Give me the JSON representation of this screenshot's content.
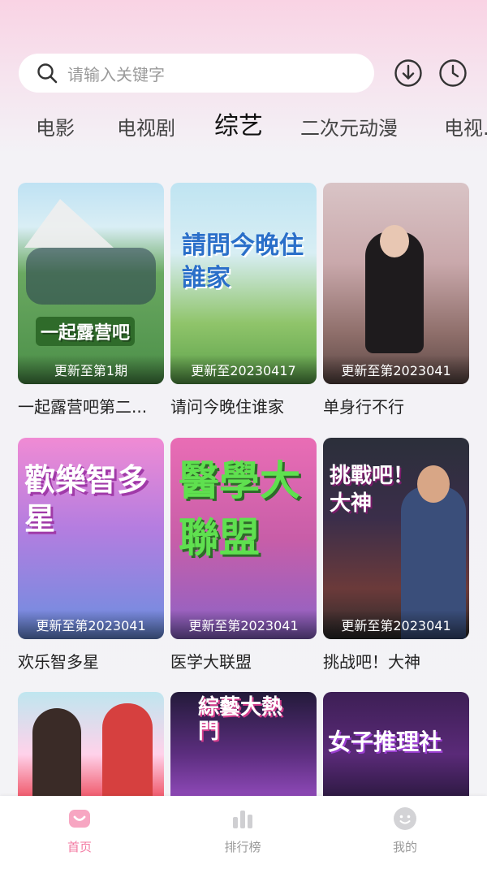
{
  "search": {
    "placeholder": "请输入关键字"
  },
  "tabs": [
    {
      "label": "电影"
    },
    {
      "label": "电视剧"
    },
    {
      "label": "综艺"
    },
    {
      "label": "二次元动漫"
    },
    {
      "label": "电视..."
    }
  ],
  "active_tab": "综艺",
  "shows": [
    {
      "title": "一起露营吧第二...",
      "badge": "更新至第1期",
      "art_text": "一起露营吧"
    },
    {
      "title": "请问今晚住谁家",
      "badge": "更新至20230417",
      "art_text": "請問今晚住誰家"
    },
    {
      "title": "单身行不行",
      "badge": "更新至第2023041",
      "art_text": ""
    },
    {
      "title": "欢乐智多星",
      "badge": "更新至第2023041",
      "art_text": "歡樂智多星"
    },
    {
      "title": "医学大联盟",
      "badge": "更新至第2023041",
      "art_text": "醫學大聯盟"
    },
    {
      "title": "挑战吧！大神",
      "badge": "更新至第2023041",
      "art_text": "挑戰吧！大神"
    },
    {
      "title": "",
      "badge": "",
      "art_text": ""
    },
    {
      "title": "",
      "badge": "",
      "art_text": "綜藝大熱門"
    },
    {
      "title": "",
      "badge": "",
      "art_text": "女子推理社"
    }
  ],
  "bottom_nav": [
    {
      "label": "首页",
      "icon": "home-icon",
      "active": true
    },
    {
      "label": "排行榜",
      "icon": "ranking-icon",
      "active": false
    },
    {
      "label": "我的",
      "icon": "profile-icon",
      "active": false
    }
  ],
  "colors": {
    "accent": "#f37aa2",
    "inactive": "#9a9a9a"
  }
}
